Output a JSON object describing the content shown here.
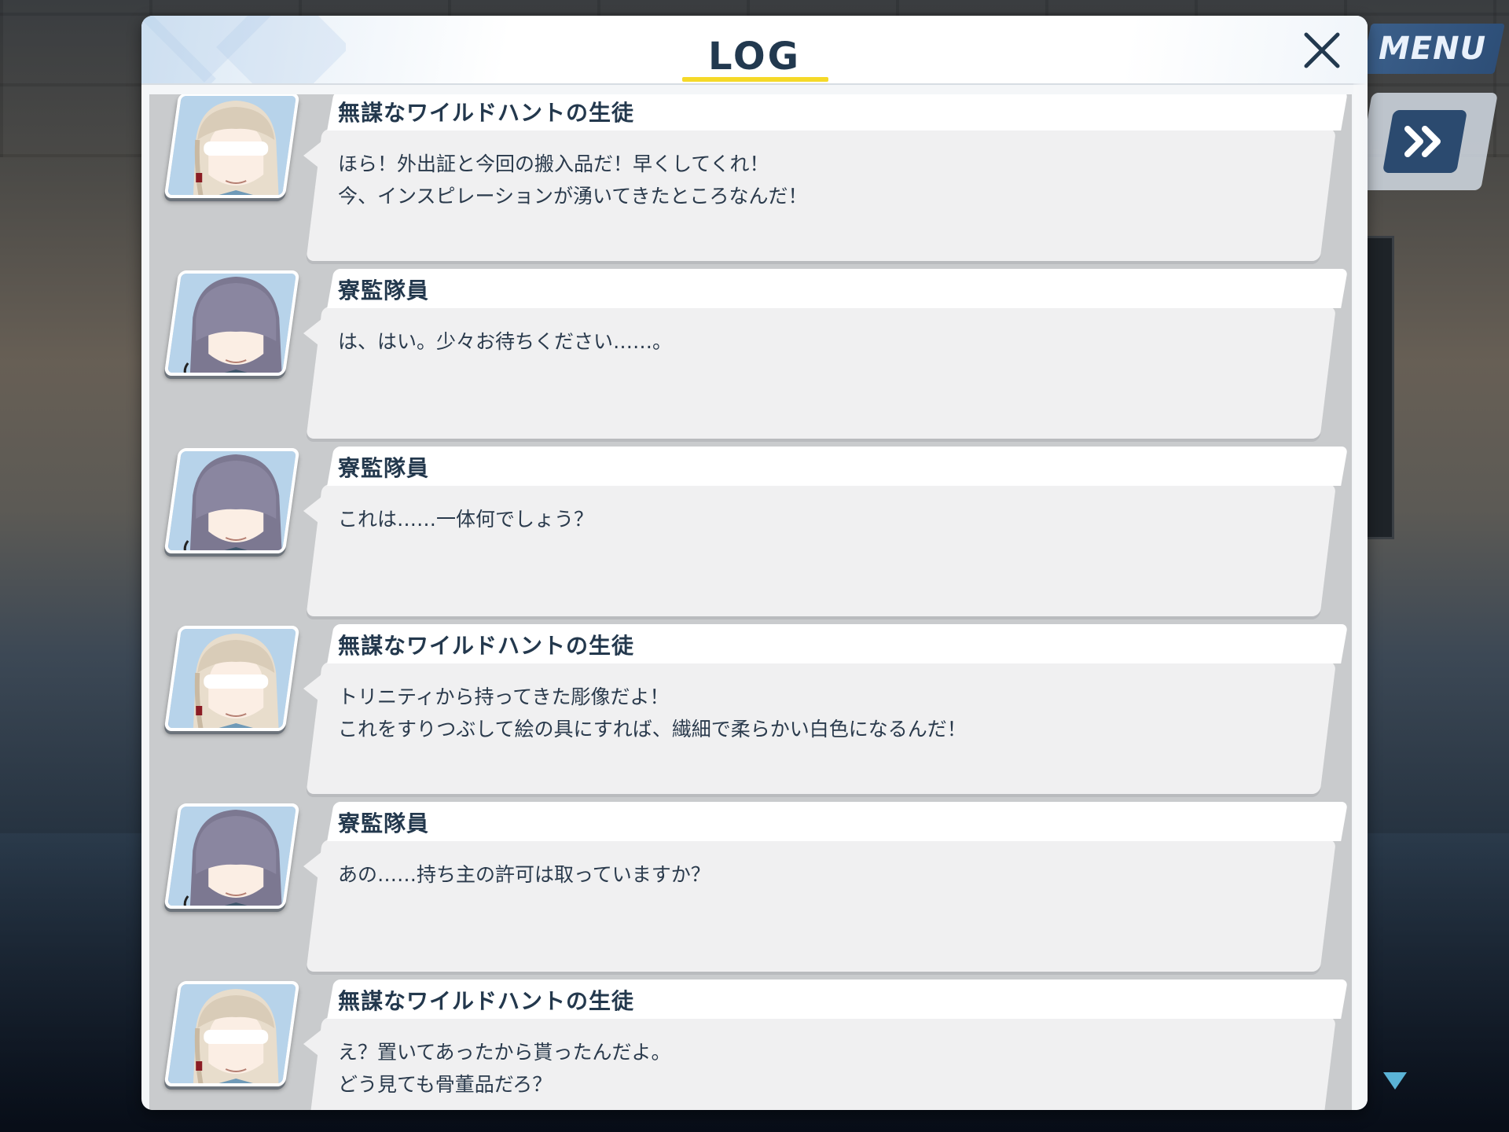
{
  "hud": {
    "menu_label": "MENU",
    "skip_icon": "double-chevron-right-icon",
    "scroll_icon": "triangle-down-icon"
  },
  "log": {
    "title": "LOG",
    "close_icon": "close-icon",
    "entries": [
      {
        "speaker": "無謀なワイルドハントの生徒",
        "portrait": "blonde-student-portrait",
        "text": "ほら！外出証と今回の搬入品だ！早くしてくれ！\n今、インスピレーションが湧いてきたところなんだ！"
      },
      {
        "speaker": "寮監隊員",
        "portrait": "dark-haired-student-portrait",
        "text": "は、はい。少々お待ちください……。"
      },
      {
        "speaker": "寮監隊員",
        "portrait": "dark-haired-student-portrait",
        "text": "これは……一体何でしょう？"
      },
      {
        "speaker": "無謀なワイルドハントの生徒",
        "portrait": "blonde-student-portrait",
        "text": "トリニティから持ってきた彫像だよ！\nこれをすりつぶして絵の具にすれば、繊細で柔らかい白色になるんだ！"
      },
      {
        "speaker": "寮監隊員",
        "portrait": "dark-haired-student-portrait",
        "text": "あの……持ち主の許可は取っていますか？"
      },
      {
        "speaker": "無謀なワイルドハントの生徒",
        "portrait": "blonde-student-portrait",
        "text": "え？置いてあったから貰ったんだよ。\nどう見ても骨董品だろ？"
      }
    ]
  },
  "colors": {
    "title_text": "#22394f",
    "title_underline": "#f5d929",
    "menu_button": "#2d4e77",
    "name_text": "#23384d"
  }
}
